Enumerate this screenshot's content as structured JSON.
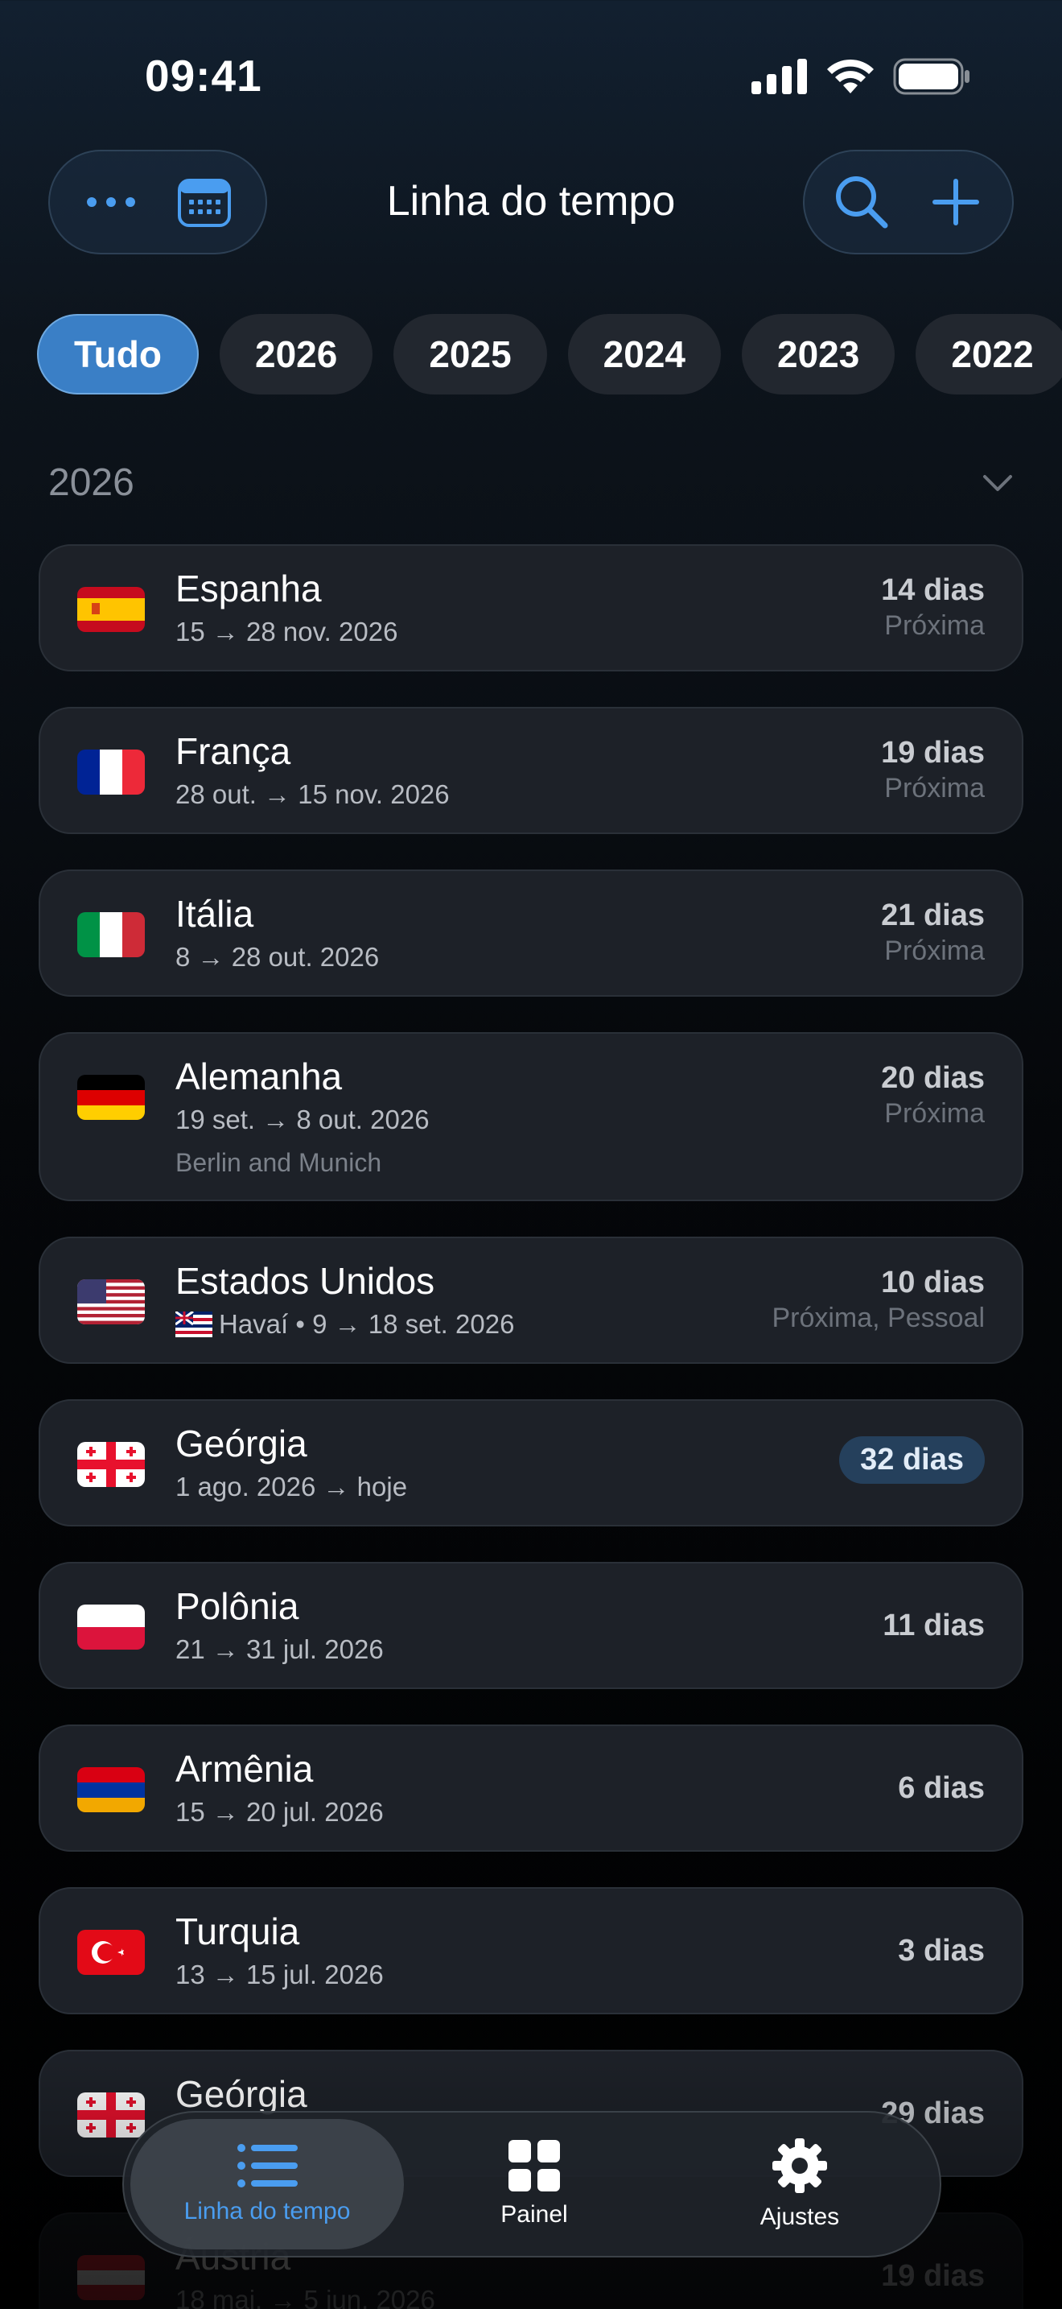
{
  "status_bar": {
    "time": "09:41"
  },
  "header": {
    "title": "Linha do tempo"
  },
  "filters": [
    "Tudo",
    "2026",
    "2025",
    "2024",
    "2023",
    "2022"
  ],
  "section": {
    "title": "2026"
  },
  "trips": [
    {
      "name": "Espanha",
      "dates": "15 → 28 nov. 2026",
      "days": "14 dias",
      "tags": "Próxima",
      "flag": "spain-flag"
    },
    {
      "name": "França",
      "dates": "28 out. → 15 nov. 2026",
      "days": "19 dias",
      "tags": "Próxima",
      "flag": "france-flag"
    },
    {
      "name": "Itália",
      "dates": "8 → 28 out. 2026",
      "days": "21 dias",
      "tags": "Próxima",
      "flag": "italy-flag"
    },
    {
      "name": "Alemanha",
      "dates": "19 set. → 8 out. 2026",
      "note": "Berlin and Munich",
      "days": "20 dias",
      "tags": "Próxima",
      "flag": "germany-flag"
    },
    {
      "name": "Estados Unidos",
      "dates": "Havaí • 9 → 18 set. 2026",
      "days": "10 dias",
      "tags": "Próxima, Pessoal",
      "flag": "usa-flag"
    },
    {
      "name": "Geórgia",
      "dates": "1 ago. 2026 → hoje",
      "days": "32 dias",
      "flag": "georgia-flag",
      "ongoing": true
    },
    {
      "name": "Polônia",
      "dates": "21 → 31 jul. 2026",
      "days": "11 dias",
      "flag": "poland-flag"
    },
    {
      "name": "Armênia",
      "dates": "15 → 20 jul. 2026",
      "days": "6 dias",
      "flag": "armenia-flag"
    },
    {
      "name": "Turquia",
      "dates": "13 → 15 jul. 2026",
      "days": "3 dias",
      "flag": "turkey-flag"
    },
    {
      "name": "Geórgia",
      "dates": "",
      "days": "29 dias",
      "flag": "georgia-flag"
    },
    {
      "name": "Áustria",
      "dates": "18 mai. → 5 jun. 2026",
      "days": "19 dias",
      "flag": "austria-flag"
    }
  ],
  "tab_bar": {
    "tabs": [
      {
        "label": "Linha do tempo",
        "icon": "list-icon",
        "active": true
      },
      {
        "label": "Painel",
        "icon": "grid-icon",
        "active": false
      },
      {
        "label": "Ajustes",
        "icon": "gear-icon",
        "active": false
      }
    ]
  },
  "colors": {
    "accent": "#3a7fc6",
    "card": "#1d2128",
    "active_tab_label": "#4a9df0"
  }
}
